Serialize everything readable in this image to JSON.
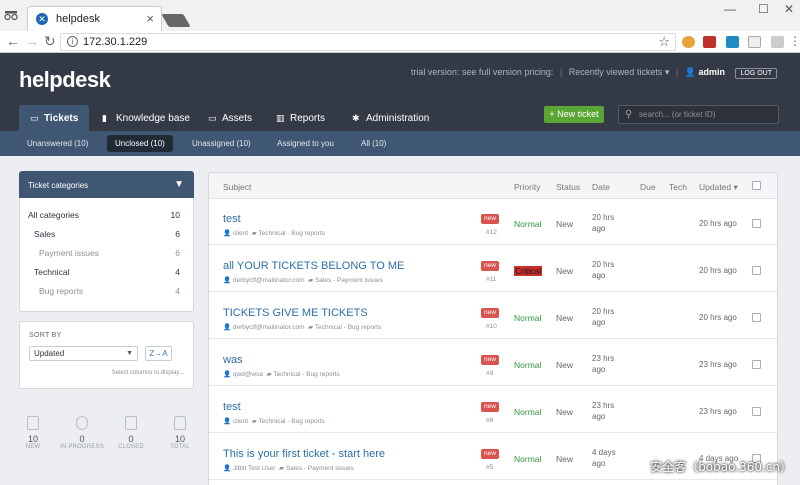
{
  "browser": {
    "tab_title": "helpdesk",
    "url": "172.30.1.229"
  },
  "app": {
    "logo": "helpdesk",
    "trial_text": "trial version:",
    "trial_link": "see full version pricing:",
    "recent_tickets": "Recently viewed tickets ▾",
    "user": "admin",
    "logout": "LOG OUT"
  },
  "mainnav": [
    {
      "label": "Tickets",
      "icon": "inbox-icon"
    },
    {
      "label": "Knowledge base",
      "icon": "book-icon"
    },
    {
      "label": "Assets",
      "icon": "monitor-icon"
    },
    {
      "label": "Reports",
      "icon": "bar-chart-icon"
    },
    {
      "label": "Administration",
      "icon": "gear-icon"
    }
  ],
  "new_ticket": "+ New ticket",
  "search_placeholder": "search... (or ticket ID)",
  "subnav": [
    "Unanswered (10)",
    "Unclosed (10)",
    "Unassigned (10)",
    "Assigned to you",
    "All (10)"
  ],
  "categories": {
    "title": "Ticket categories",
    "items": [
      {
        "name": "All categories",
        "count": "10"
      },
      {
        "name": "Sales",
        "count": "6"
      },
      {
        "name": "Payment issues",
        "count": "6"
      },
      {
        "name": "Technical",
        "count": "4"
      },
      {
        "name": "Bug reports",
        "count": "4"
      }
    ]
  },
  "sort": {
    "label": "SORT BY",
    "value": "Updated",
    "direction": "Z→A",
    "hint": "Select columns to display..."
  },
  "stats": [
    {
      "num": "10",
      "label": "NEW"
    },
    {
      "num": "0",
      "label": "IN PROGRESS"
    },
    {
      "num": "0",
      "label": "CLOSED"
    },
    {
      "num": "10",
      "label": "TOTAL"
    }
  ],
  "table": {
    "headers": {
      "subject": "Subject",
      "priority": "Priority",
      "status": "Status",
      "date": "Date",
      "due": "Due",
      "tech": "Tech",
      "updated": "Updated ▾"
    },
    "rows": [
      {
        "subject": "test",
        "user": "client",
        "category": "Technical - Bug reports",
        "badge": "new",
        "id": "#12",
        "priority": "Normal",
        "status": "New",
        "date": "20 hrs ago",
        "updated": "20 hrs ago"
      },
      {
        "subject": "all YOUR TICKETS BELONG TO ME",
        "user": "derbyctf@mailinator.com",
        "category": "Sales - Payment issues",
        "badge": "new",
        "id": "#11",
        "priority": "Critical",
        "status": "New",
        "date": "20 hrs ago",
        "updated": "20 hrs ago"
      },
      {
        "subject": "TICKETS GIVE ME TICKETS",
        "user": "derbyctf@mailinator.com",
        "category": "Technical - Bug reports",
        "badge": "new",
        "id": "#10",
        "priority": "Normal",
        "status": "New",
        "date": "20 hrs ago",
        "updated": "20 hrs ago"
      },
      {
        "subject": "was",
        "user": "qwd@wsa",
        "category": "Technical - Bug reports",
        "badge": "new",
        "id": "#9",
        "priority": "Normal",
        "status": "New",
        "date": "23 hrs ago",
        "updated": "23 hrs ago"
      },
      {
        "subject": "test",
        "user": "client",
        "category": "Technical - Bug reports",
        "badge": "new",
        "id": "#8",
        "priority": "Normal",
        "status": "New",
        "date": "23 hrs ago",
        "updated": "23 hrs ago"
      },
      {
        "subject": "This is your first ticket - start here",
        "user": "Jitbit Test User",
        "category": "Sales - Payment issues",
        "badge": "new",
        "id": "#5",
        "priority": "Normal",
        "status": "New",
        "date": "4 days ago",
        "updated": "4 days ago"
      }
    ]
  },
  "watermark": "安全客（bobao.360.cn）"
}
